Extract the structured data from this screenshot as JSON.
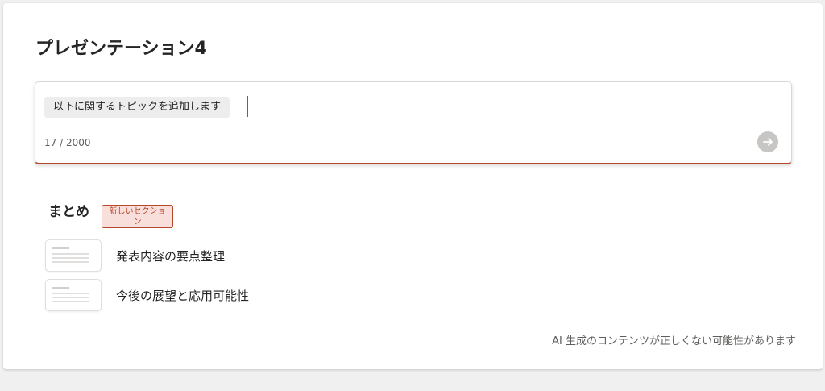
{
  "title": "プレゼンテーション4",
  "prompt": {
    "text": "以下に関するトピックを追加します",
    "char_count": "17 / 2000",
    "send_icon": "arrow-right-icon"
  },
  "section": {
    "heading": "まとめ",
    "badge": "新しいセクション",
    "topics": [
      {
        "label": "発表内容の要点整理"
      },
      {
        "label": "今後の展望と応用可能性"
      }
    ]
  },
  "disclaimer": "AI 生成のコンテンツが正しくない可能性があります",
  "colors": {
    "accent": "#b7472a",
    "badge_bg": "#f9dfdb",
    "send_button": "#c8c6c4"
  }
}
